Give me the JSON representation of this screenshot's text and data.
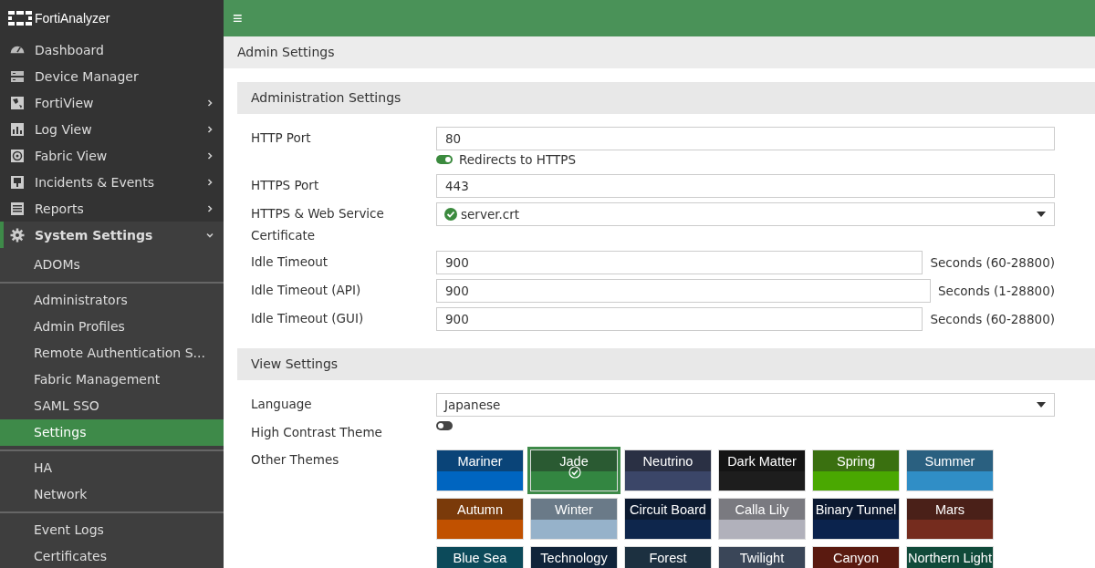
{
  "app": {
    "logo": "FortiAnalyzer",
    "menu_glyph": "≡"
  },
  "sidebar": {
    "main_items": [
      {
        "label": "Dashboard",
        "kind": "link",
        "selected": false
      },
      {
        "label": "Device Manager",
        "kind": "link",
        "selected": false
      },
      {
        "label": "FortiView",
        "kind": "menu",
        "expanded": false,
        "selected": false
      },
      {
        "label": "Log View",
        "kind": "menu",
        "expanded": false,
        "selected": false
      },
      {
        "label": "Fabric View",
        "kind": "menu",
        "expanded": false,
        "selected": false
      },
      {
        "label": "Incidents & Events",
        "kind": "menu",
        "expanded": false,
        "selected": false
      },
      {
        "label": "Reports",
        "kind": "menu",
        "expanded": false,
        "selected": false
      },
      {
        "label": "System Settings",
        "kind": "menu",
        "expanded": true,
        "selected": true
      }
    ],
    "sub_groups": [
      [
        {
          "label": "ADOMs",
          "selected": false
        }
      ],
      [
        {
          "label": "Administrators",
          "selected": false
        },
        {
          "label": "Admin Profiles",
          "selected": false
        },
        {
          "label": "Remote Authentication S...",
          "selected": false
        },
        {
          "label": "Fabric Management",
          "selected": false
        },
        {
          "label": "SAML SSO",
          "selected": false
        },
        {
          "label": "Settings",
          "selected": true
        }
      ],
      [
        {
          "label": "HA",
          "selected": false
        },
        {
          "label": "Network",
          "selected": false
        }
      ],
      [
        {
          "label": "Event Logs",
          "selected": false
        },
        {
          "label": "Certificates",
          "selected": false
        }
      ]
    ]
  },
  "page_title": "Admin Settings",
  "administration": {
    "title": "Administration Settings",
    "http_port": {
      "label": "HTTP Port",
      "value": "80"
    },
    "redirect": {
      "label": "Redirects to HTTPS",
      "on": true
    },
    "https_port": {
      "label": "HTTPS Port",
      "value": "443"
    },
    "certificate": {
      "label": "HTTPS & Web Service Certificate",
      "value": "server.crt"
    },
    "timeouts": [
      {
        "label": "Idle Timeout",
        "value": "900",
        "suffix": "Seconds (60-28800)"
      },
      {
        "label": "Idle Timeout (API)",
        "value": "900",
        "suffix": "Seconds (1-28800)"
      },
      {
        "label": "Idle Timeout (GUI)",
        "value": "900",
        "suffix": "Seconds (60-28800)"
      }
    ]
  },
  "view": {
    "title": "View Settings",
    "language": {
      "label": "Language",
      "value": "Japanese"
    },
    "high_contrast": {
      "label": "High Contrast Theme",
      "on": false
    },
    "themes_label": "Other Themes",
    "themes": [
      {
        "name": "Mariner",
        "color": "#0a4478",
        "selected": false
      },
      {
        "name": "Jade",
        "color": "#2a5a32",
        "selected": true
      },
      {
        "name": "Neutrino",
        "color": "#2a3044",
        "selected": false
      },
      {
        "name": "Dark Matter",
        "color": "#141414",
        "selected": false
      },
      {
        "name": "Spring",
        "color": "#3a7010",
        "selected": false
      },
      {
        "name": "Summer",
        "color": "#2a6080",
        "selected": false
      },
      {
        "name": "Autumn",
        "color": "#7a3a0a",
        "selected": false
      },
      {
        "name": "Winter",
        "color": "#6a7a88",
        "selected": false
      },
      {
        "name": "Circuit Board",
        "color": "#0c1a30",
        "selected": false
      },
      {
        "name": "Calla Lily",
        "color": "#7a7a80",
        "selected": false
      },
      {
        "name": "Binary Tunnel",
        "color": "#0a1830",
        "selected": false
      },
      {
        "name": "Mars",
        "color": "#4a2018",
        "selected": false
      },
      {
        "name": "Blue Sea",
        "color": "#0c4a5a",
        "selected": false
      },
      {
        "name": "Technology",
        "color": "#10243a",
        "selected": false
      },
      {
        "name": "Forest",
        "color": "#1c3040",
        "selected": false
      },
      {
        "name": "Twilight",
        "color": "#3a4658",
        "selected": false
      },
      {
        "name": "Canyon",
        "color": "#5a1a10",
        "selected": false
      },
      {
        "name": "Northern Light",
        "color": "#104a3a",
        "selected": false
      }
    ]
  }
}
